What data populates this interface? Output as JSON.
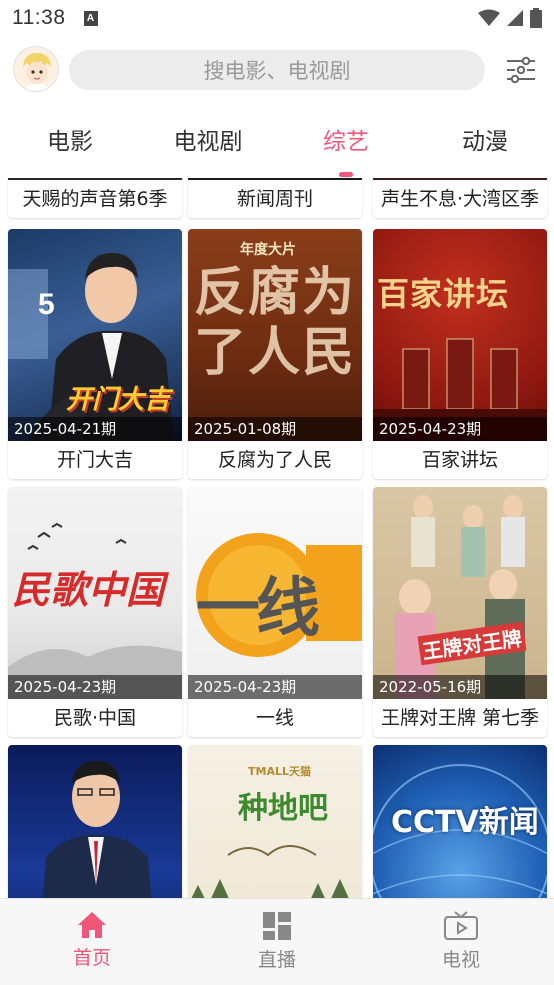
{
  "status": {
    "time": "11:38",
    "notif_letter": "A"
  },
  "search": {
    "placeholder": "搜电影、电视剧"
  },
  "tabs": [
    {
      "label": "电影"
    },
    {
      "label": "电视剧"
    },
    {
      "label": "综艺",
      "active": true
    },
    {
      "label": "动漫"
    }
  ],
  "accent_color": "#f0557a",
  "top_partial_titles": [
    "天赐的声音第6季",
    "新闻周刊",
    "声生不息·大湾区季"
  ],
  "cards": [
    {
      "title": "开门大吉",
      "date": "2025-04-21期",
      "poster_text": "开门大吉"
    },
    {
      "title": "反腐为了人民",
      "date": "2025-01-08期",
      "poster_text": "反腐为了人民",
      "poster_subtext": "年度大片"
    },
    {
      "title": "百家讲坛",
      "date": "2025-04-23期",
      "poster_text": "百家讲坛"
    },
    {
      "title": "民歌·中国",
      "date": "2025-04-23期",
      "poster_text": "民歌中国"
    },
    {
      "title": "一线",
      "date": "2025-04-23期",
      "poster_text": "一线"
    },
    {
      "title": "王牌对王牌 第七季",
      "date": "2022-05-16期",
      "poster_text": "王牌对王牌"
    },
    {
      "title": "",
      "date": "",
      "poster_text": ""
    },
    {
      "title": "",
      "date": "",
      "poster_text": "种地吧",
      "poster_subtext": "TMALL天猫"
    },
    {
      "title": "",
      "date": "",
      "poster_text": "CCTV新闻"
    }
  ],
  "bottom_nav": [
    {
      "label": "首页",
      "icon": "home-icon",
      "active": true
    },
    {
      "label": "直播",
      "icon": "grid-icon"
    },
    {
      "label": "电视",
      "icon": "tv-icon"
    }
  ]
}
